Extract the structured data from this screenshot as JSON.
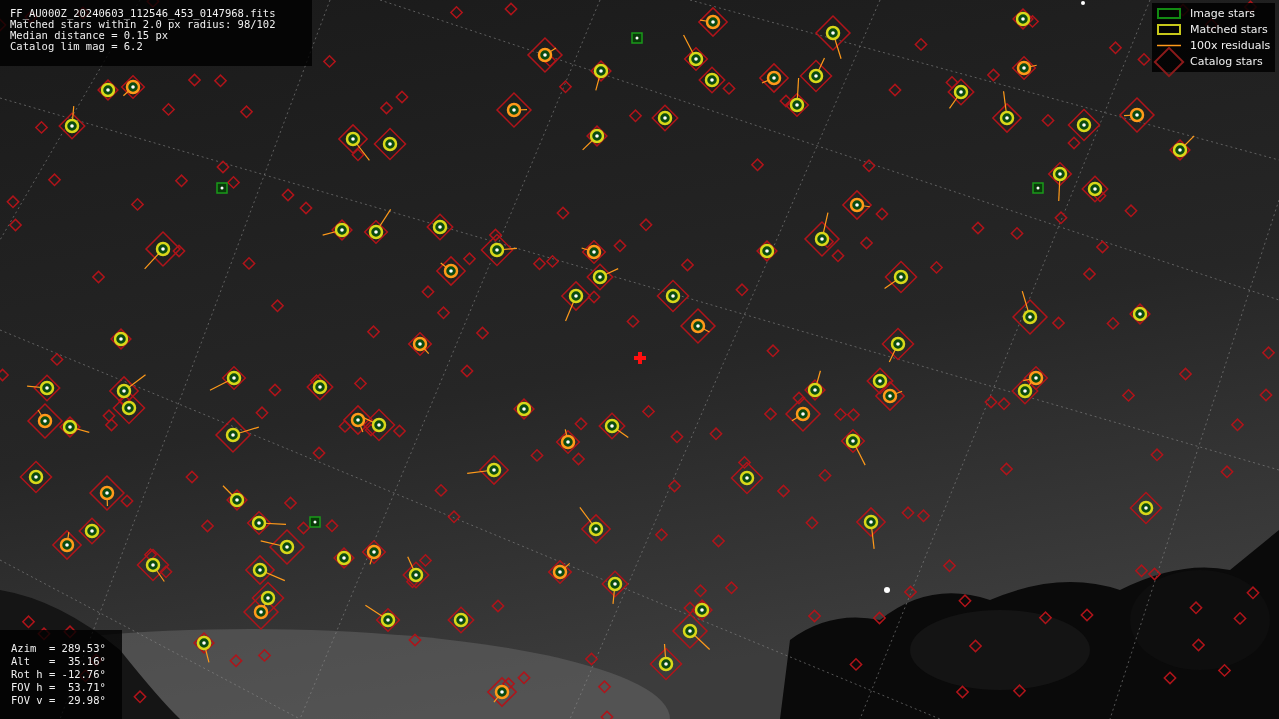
{
  "header": {
    "lines": [
      "FF_AU000Z_20240603_112546_453_0147968.fits",
      "Matched stars within 2.0 px radius: 98/102",
      "Median distance = 0.15 px",
      "Catalog lim mag = 6.2"
    ]
  },
  "legend": [
    {
      "kind": "image",
      "label": "Image stars"
    },
    {
      "kind": "matched",
      "label": "Matched stars"
    },
    {
      "kind": "residual",
      "label": "100x residuals"
    },
    {
      "kind": "catalog",
      "label": "Catalog stars"
    }
  ],
  "pointing": {
    "lines": [
      "Azim  = 289.53°",
      "Alt   =  35.16°",
      "Rot h = -12.76°",
      "FOV h =  53.71°",
      "FOV v =  29.98°"
    ]
  }
}
